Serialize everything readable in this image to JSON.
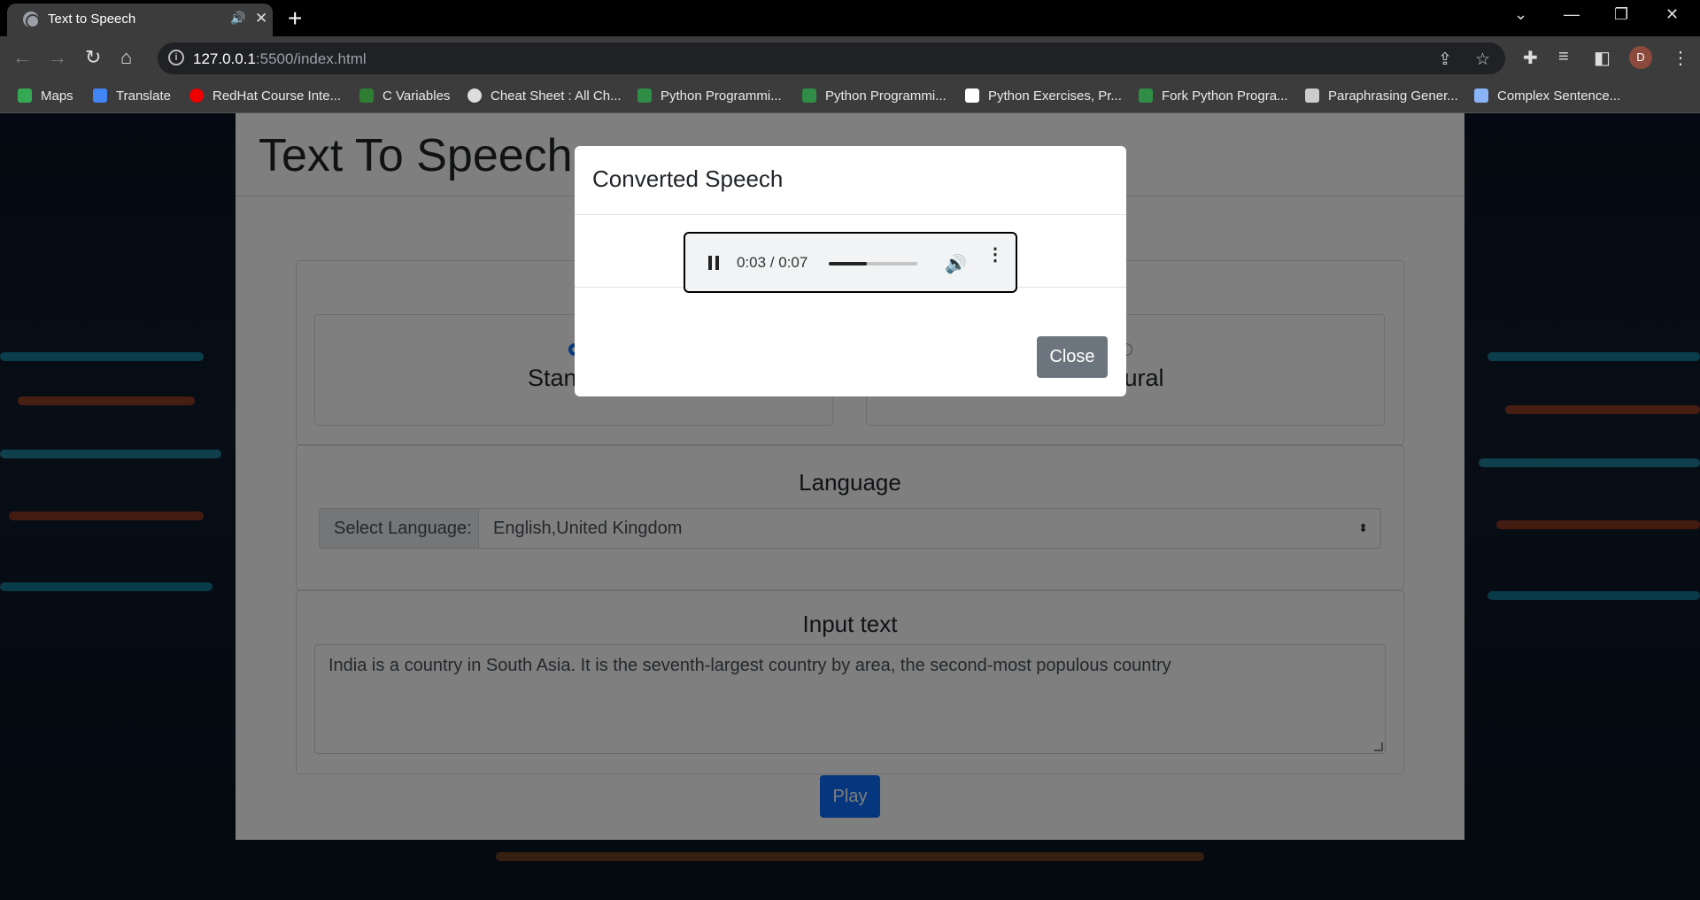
{
  "browser": {
    "tab_title": "Text to Speech",
    "tab_speaker": "🔊",
    "tab_close": "✕",
    "new_tab": "+",
    "url_host": "127.0.0.1",
    "url_rest": ":5500/index.html",
    "avatar_letter": "D",
    "win_dropdown": "⌄",
    "win_minimize": "—",
    "win_restore": "❐",
    "win_close": "✕"
  },
  "bookmarks": [
    {
      "label": "Maps",
      "color": "#34a853"
    },
    {
      "label": "Translate",
      "color": "#4285f4"
    },
    {
      "label": "RedHat Course Inte...",
      "color": "#e00"
    },
    {
      "label": "C Variables",
      "color": "#2e7d32"
    },
    {
      "label": "Cheat Sheet : All Ch...",
      "color": "#dddddd"
    },
    {
      "label": "Python Programmi...",
      "color": "#2f8d46"
    },
    {
      "label": "Python Programmi...",
      "color": "#2f8d46"
    },
    {
      "label": "Python Exercises, Pr...",
      "color": "#ffffff"
    },
    {
      "label": "Fork Python Progra...",
      "color": "#2f8d46"
    },
    {
      "label": "Paraphrasing Gener...",
      "color": "#cccccc"
    },
    {
      "label": "Complex Sentence...",
      "color": "#8ab4f8"
    }
  ],
  "page": {
    "heading": "Text To Speech",
    "voice_standard": "Standard",
    "voice_neural": "Neural",
    "language_title": "Language",
    "select_label": "Select Language:",
    "select_value": "English,United Kingdom",
    "input_title": "Input text",
    "input_text": "India is a country in South Asia. It is the seventh-largest country by area, the second-most populous country",
    "play_label": "Play"
  },
  "modal": {
    "title": "Converted Speech",
    "time": "0:03 / 0:07",
    "progress": 0.43,
    "close_label": "Close"
  }
}
